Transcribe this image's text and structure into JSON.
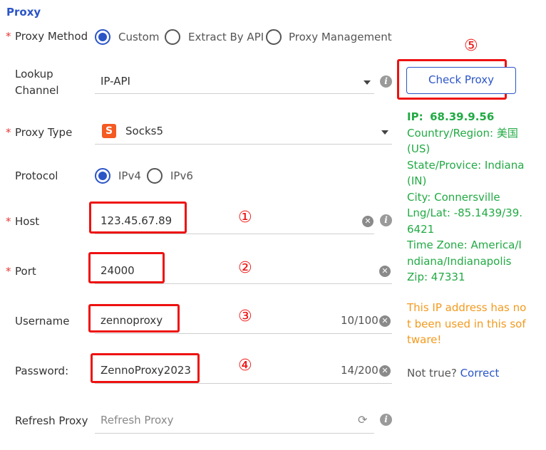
{
  "section": {
    "title": "Proxy"
  },
  "proxy_method": {
    "label": "Proxy Method",
    "required": "*",
    "options": [
      "Custom",
      "Extract By API",
      "Proxy Management"
    ],
    "selected": "Custom"
  },
  "lookup_channel": {
    "label_line1": "Lookup",
    "label_line2": "Channel",
    "value": "IP-API",
    "info_icon": "info-icon"
  },
  "proxy_type": {
    "label": "Proxy Type",
    "required": "*",
    "value": "Socks5",
    "badge_letter": "S"
  },
  "protocol": {
    "label": "Protocol",
    "options": [
      "IPv4",
      "IPv6"
    ],
    "selected": "IPv4"
  },
  "host": {
    "label": "Host",
    "required": "*",
    "value": "123.45.67.89"
  },
  "port": {
    "label": "Port",
    "required": "*",
    "value": "24000"
  },
  "username": {
    "label": "Username",
    "value": "zennoproxy",
    "counter": "10/100"
  },
  "password": {
    "label": "Password:",
    "value": "ZennoProxy2023",
    "counter": "14/200"
  },
  "refresh_proxy": {
    "label": "Refresh Proxy",
    "placeholder": "Refresh Proxy"
  },
  "annotations": {
    "n1": "①",
    "n2": "②",
    "n3": "③",
    "n4": "④",
    "n5": "⑤"
  },
  "check_proxy": {
    "label": "Check Proxy"
  },
  "result": {
    "ip_label": "IP:",
    "ip_value": "68.39.9.56",
    "lines": [
      "Country/Region: 美国",
      "(US)",
      "State/Provice: Indiana",
      "(IN)",
      "City: Connersville",
      "Lng/Lat: -85.1439/39.",
      "6421",
      "Time Zone: America/I",
      "ndiana/Indianapolis",
      "Zip: 47331"
    ],
    "warning_lines": [
      "This IP address has no",
      "t been used in this sof",
      "tware!"
    ],
    "not_true_text": "Not true?",
    "correct_link": "Correct"
  },
  "colors": {
    "accent": "#2b55c7",
    "required": "#e53935",
    "success": "#22aa44",
    "warning": "#f39a1e",
    "annotation": "#ee1111"
  }
}
